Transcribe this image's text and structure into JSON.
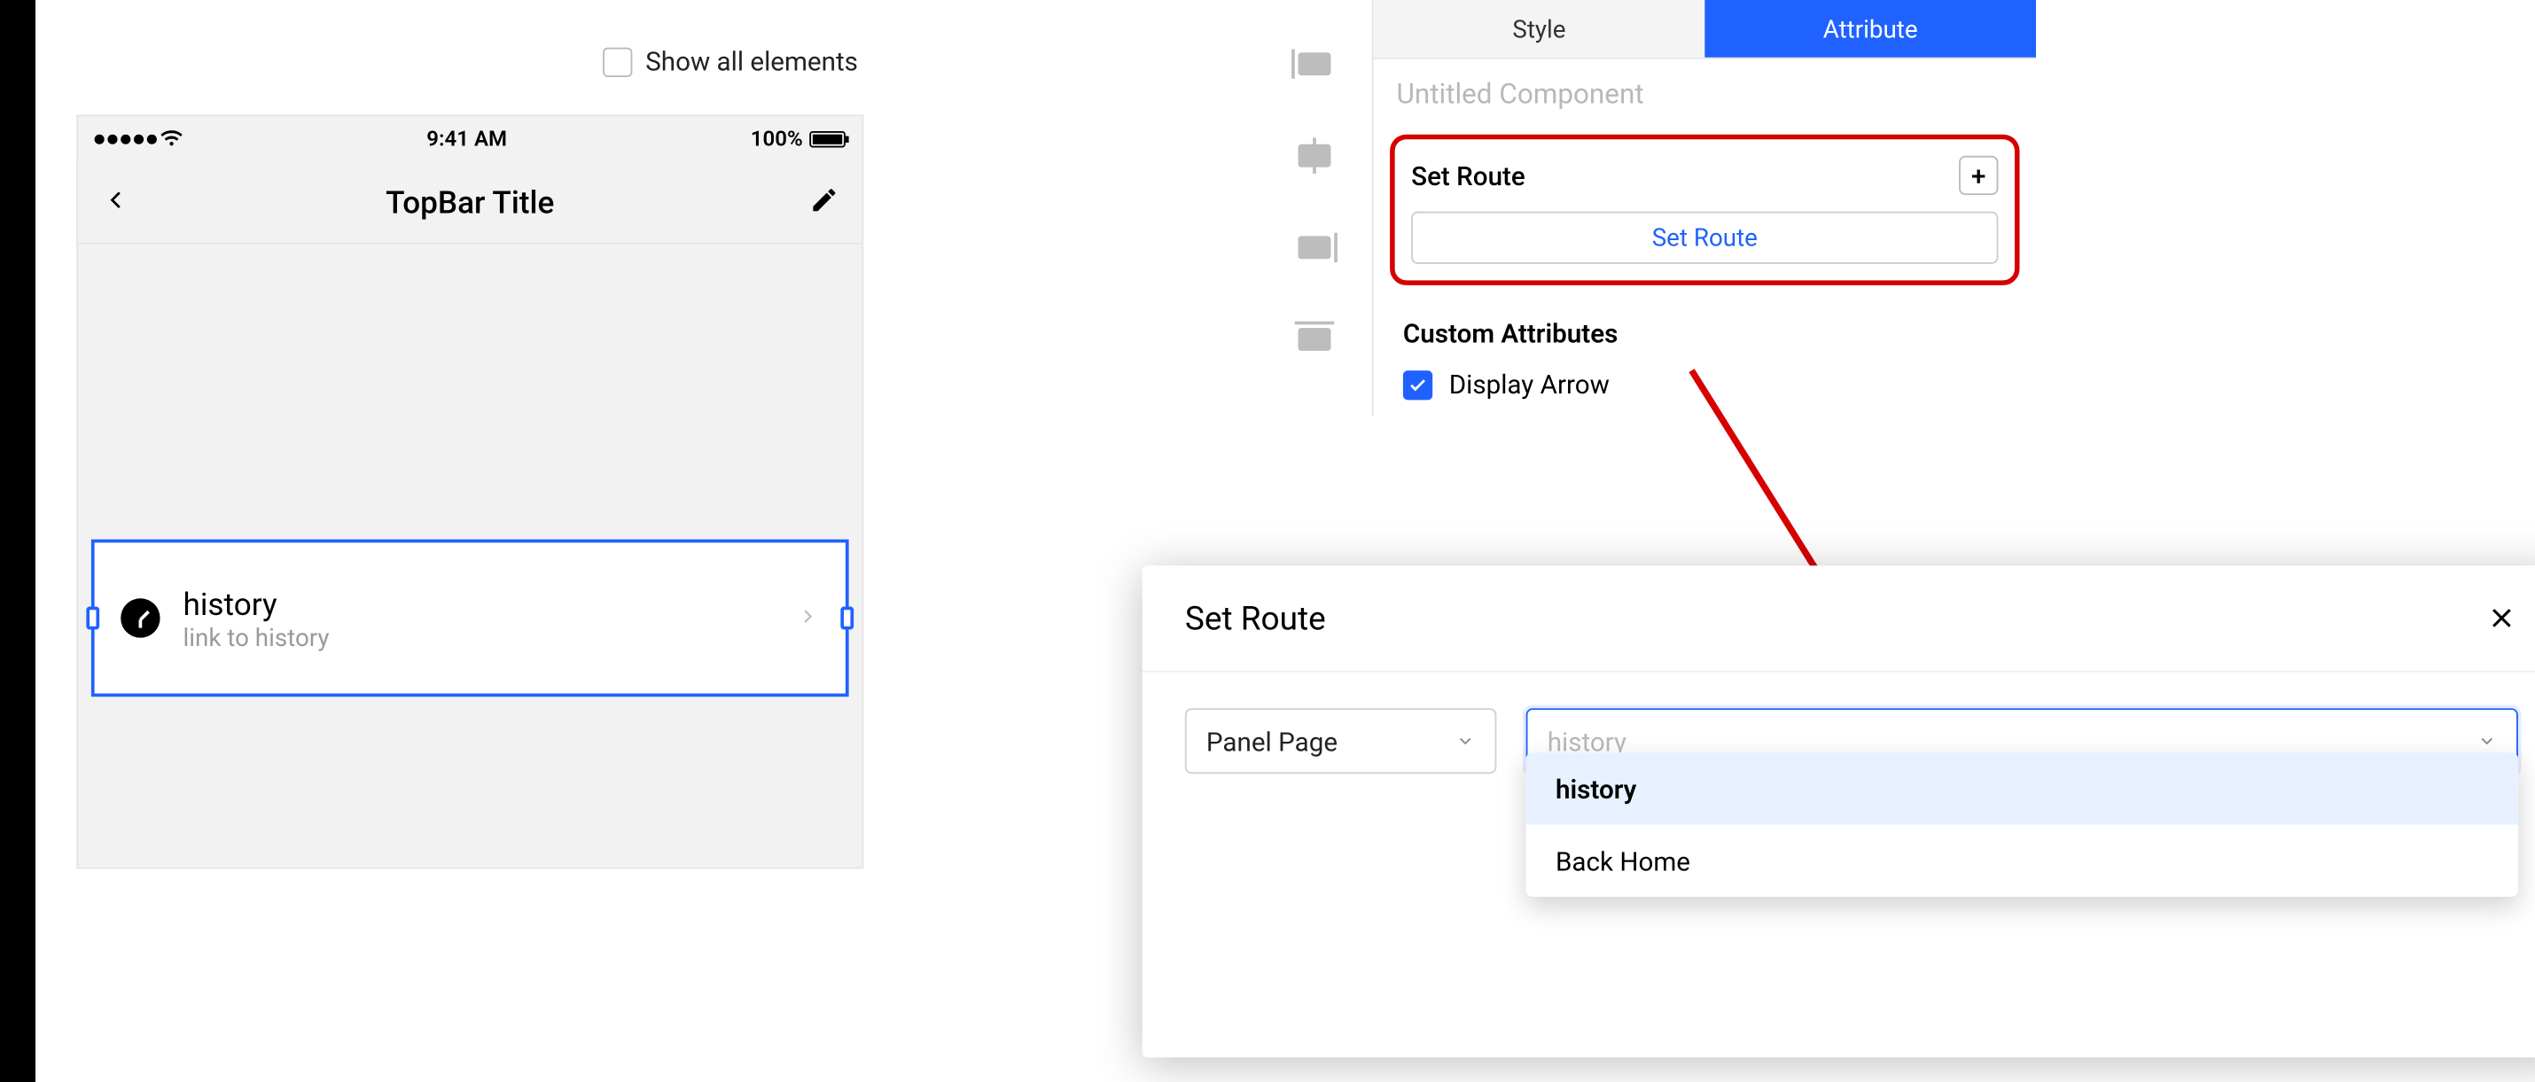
{
  "canvas": {
    "show_all_label": "Show all elements",
    "statusbar_time": "9:41 AM",
    "statusbar_battery": "100%",
    "topbar_title": "TopBar Title",
    "list_item": {
      "title": "history",
      "subtitle": "link to history"
    }
  },
  "panel": {
    "tabs": {
      "style": "Style",
      "attribute": "Attribute"
    },
    "component_name": "Untitled Component",
    "set_route_header": "Set Route",
    "set_route_button": "Set Route",
    "custom_attrs_header": "Custom Attributes",
    "display_arrow_label": "Display Arrow"
  },
  "modal": {
    "title": "Set Route",
    "type_select": "Panel Page",
    "route_placeholder": "history",
    "options": [
      "history",
      "Back Home"
    ]
  }
}
